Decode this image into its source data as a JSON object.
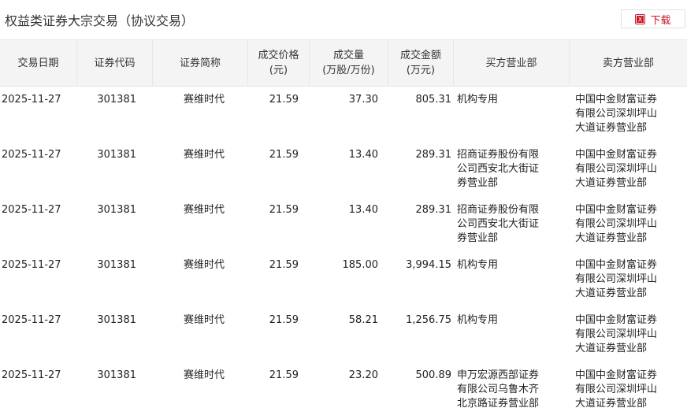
{
  "header": {
    "title": "权益类证券大宗交易（协议交易）",
    "download_label": "下载"
  },
  "columns": [
    {
      "line1": "交易日期",
      "line2": ""
    },
    {
      "line1": "证券代码",
      "line2": ""
    },
    {
      "line1": "证券简称",
      "line2": ""
    },
    {
      "line1": "成交价格",
      "line2": "(元)"
    },
    {
      "line1": "成交量",
      "line2": "(万股/万份)"
    },
    {
      "line1": "成交金额",
      "line2": "(万元)"
    },
    {
      "line1": "买方营业部",
      "line2": ""
    },
    {
      "line1": "卖方营业部",
      "line2": ""
    }
  ],
  "rows": [
    {
      "date": "2025-11-27",
      "code": "301381",
      "name": "赛维时代",
      "price": "21.59",
      "volume": "37.30",
      "amount": "805.31",
      "buyer": "机构专用",
      "seller": "中国中金财富证券有限公司深圳坪山大道证券营业部"
    },
    {
      "date": "2025-11-27",
      "code": "301381",
      "name": "赛维时代",
      "price": "21.59",
      "volume": "13.40",
      "amount": "289.31",
      "buyer": "招商证券股份有限公司西安北大街证券营业部",
      "seller": "中国中金财富证券有限公司深圳坪山大道证券营业部"
    },
    {
      "date": "2025-11-27",
      "code": "301381",
      "name": "赛维时代",
      "price": "21.59",
      "volume": "13.40",
      "amount": "289.31",
      "buyer": "招商证券股份有限公司西安北大街证券营业部",
      "seller": "中国中金财富证券有限公司深圳坪山大道证券营业部"
    },
    {
      "date": "2025-11-27",
      "code": "301381",
      "name": "赛维时代",
      "price": "21.59",
      "volume": "185.00",
      "amount": "3,994.15",
      "buyer": "机构专用",
      "seller": "中国中金财富证券有限公司深圳坪山大道证券营业部"
    },
    {
      "date": "2025-11-27",
      "code": "301381",
      "name": "赛维时代",
      "price": "21.59",
      "volume": "58.21",
      "amount": "1,256.75",
      "buyer": "机构专用",
      "seller": "中国中金财富证券有限公司深圳坪山大道证券营业部"
    },
    {
      "date": "2025-11-27",
      "code": "301381",
      "name": "赛维时代",
      "price": "21.59",
      "volume": "23.20",
      "amount": "500.89",
      "buyer": "申万宏源西部证券有限公司乌鲁木齐北京路证券营业部",
      "seller": "中国中金财富证券有限公司深圳坪山大道证券营业部"
    }
  ]
}
